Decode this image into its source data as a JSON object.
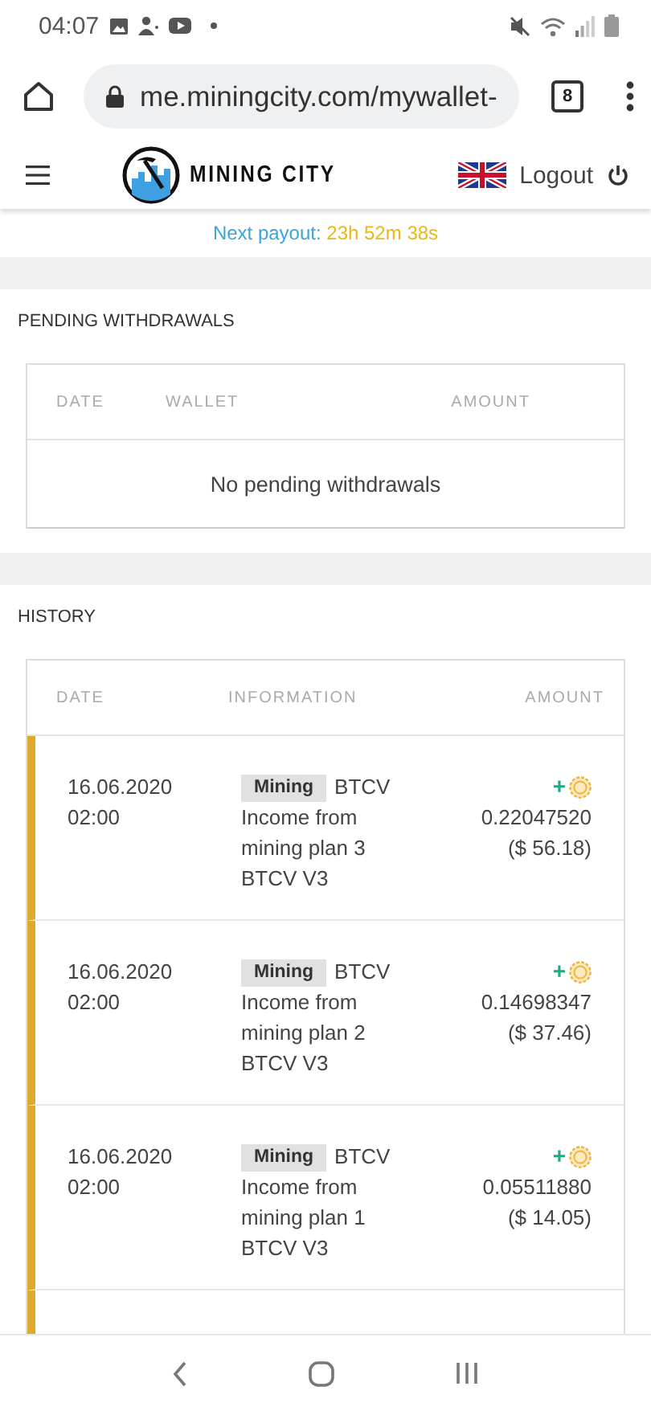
{
  "status_bar": {
    "time": "04:07"
  },
  "browser": {
    "url": "me.miningcity.com/mywallet-",
    "tab_count": "8"
  },
  "header": {
    "brand": "MINING CITY",
    "logout": "Logout"
  },
  "payout": {
    "label": "Next payout:",
    "countdown": "23h 52m 38s"
  },
  "pending": {
    "title": "PENDING WITHDRAWALS",
    "columns": [
      "DATE",
      "WALLET",
      "AMOUNT"
    ],
    "empty_message": "No pending withdrawals"
  },
  "history": {
    "title": "HISTORY",
    "columns": [
      "DATE",
      "INFORMATION",
      "AMOUNT"
    ],
    "rows": [
      {
        "date": "16.06.2020",
        "time": "02:00",
        "tag": "Mining",
        "currency": "BTCV",
        "description": "Income from mining plan 3 BTCV V3",
        "sign": "+",
        "amount": "0.22047520",
        "usd": "($ 56.18)"
      },
      {
        "date": "16.06.2020",
        "time": "02:00",
        "tag": "Mining",
        "currency": "BTCV",
        "description": "Income from mining plan 2 BTCV V3",
        "sign": "+",
        "amount": "0.14698347",
        "usd": "($ 37.46)"
      },
      {
        "date": "16.06.2020",
        "time": "02:00",
        "tag": "Mining",
        "currency": "BTCV",
        "description": "Income from mining plan 1 BTCV V3",
        "sign": "+",
        "amount": "0.05511880",
        "usd": "($ 14.05)"
      }
    ]
  }
}
